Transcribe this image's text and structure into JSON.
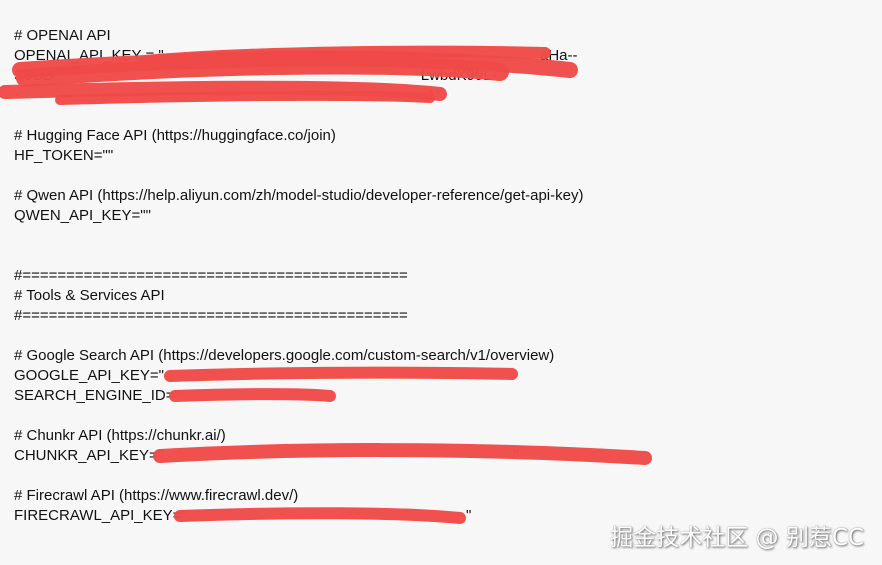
{
  "lines": [
    "# OPENAI API",
    "OPENAI_API_KEY = \"",
    "S6UD                                                                                        LwbdK99L-",
    "                                                                                                   A\"",
    "",
    "# Hugging Face API (https://huggingface.co/join)",
    "HF_TOKEN=\"\"",
    "",
    "# Qwen API (https://help.aliyun.com/zh/model-studio/developer-reference/get-api-key)",
    "QWEN_API_KEY=\"\"",
    "",
    "",
    "#============================================",
    "# Tools & Services API",
    "#============================================",
    "",
    "# Google Search API (https://developers.google.com/custom-search/v1/overview)",
    "GOOGLE_API_KEY=\"",
    "SEARCH_ENGINE_ID=\"",
    "",
    "# Chunkr API (https://chunkr.ai/)",
    "CHUNKR_API_KEY=\"                                                                                    \"",
    "",
    "# Firecrawl API (https://www.firecrawl.dev/)",
    "FIRECRAWL_API_KEY=\"                                                                   \""
  ],
  "openai_key_tail": "aHa--",
  "watermark": "掘金技术社区 @ 别惹CC",
  "redaction_color": "#f04a48"
}
